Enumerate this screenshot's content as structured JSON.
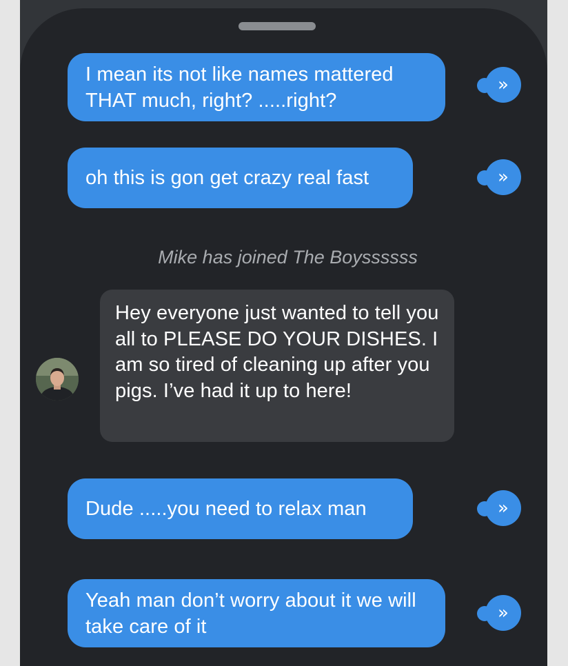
{
  "chat": {
    "messages": [
      {
        "text": "I mean its not like names mattered THAT much, right? .....right?"
      },
      {
        "text": "oh this is gon get crazy real fast"
      },
      {
        "text": "Hey everyone just wanted to tell you all to PLEASE DO YOUR DISHES. I am so tired of cleaning up after you pigs. I’ve had it up to here!"
      },
      {
        "text": "Dude .....you need to relax man"
      },
      {
        "text": "Yeah man don’t worry about it we will take care of it"
      }
    ],
    "system_notice": "Mike has joined The Boyssssss",
    "send_glyph": "»"
  },
  "colors": {
    "outgoing_bubble": "#3a8ee6",
    "incoming_bubble": "#3a3c40",
    "background": "#222428"
  },
  "icons": {
    "status": "double-chevron-right-icon",
    "avatar": "user-avatar"
  }
}
